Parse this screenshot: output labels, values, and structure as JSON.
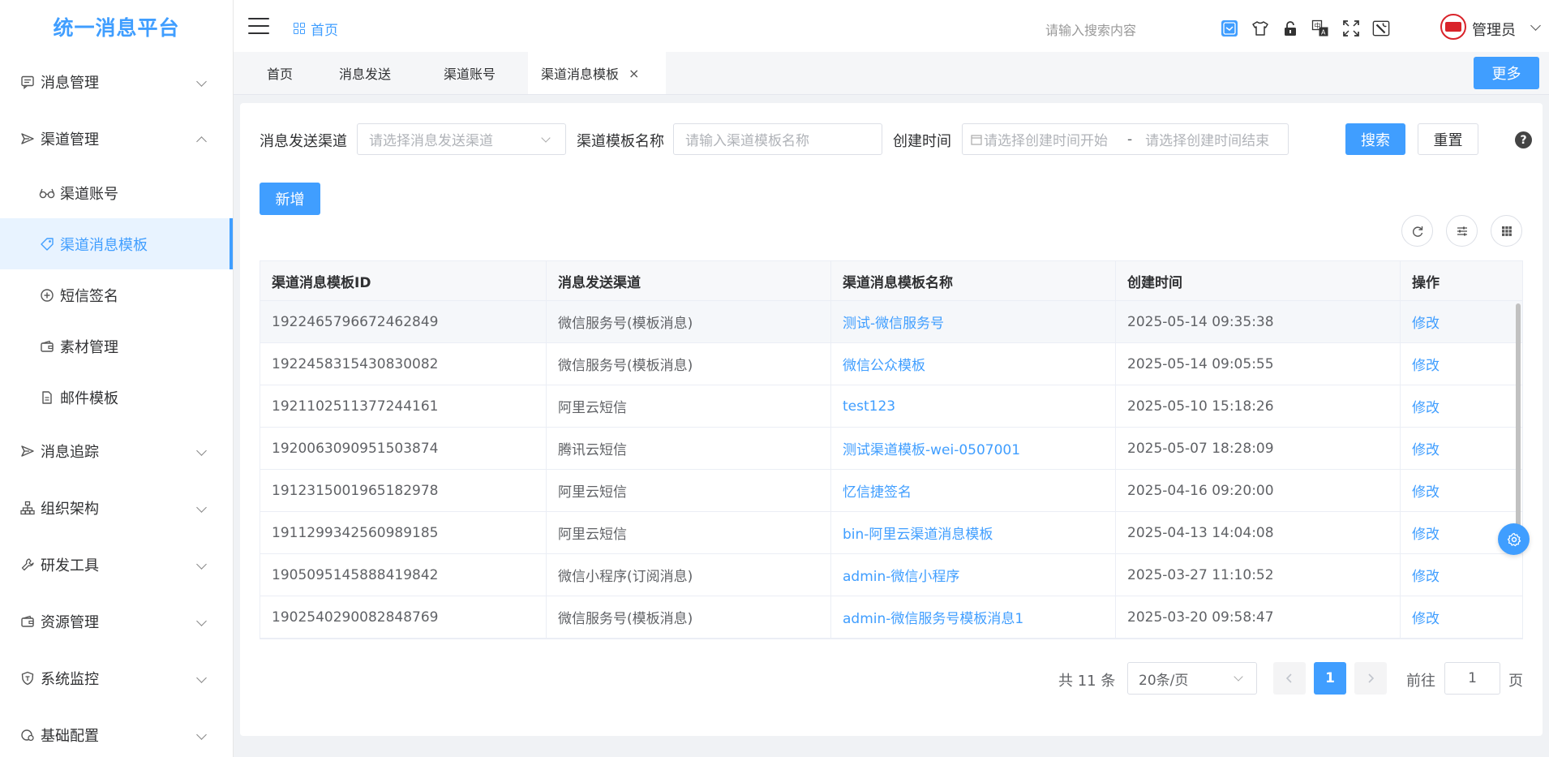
{
  "app": {
    "title": "统一消息平台"
  },
  "header": {
    "breadcrumb": "首页",
    "search_placeholder": "请输入搜索内容",
    "user_name": "管理员"
  },
  "sidebar": {
    "items": [
      {
        "label": "消息管理",
        "icon": "message-icon",
        "expanded": false
      },
      {
        "label": "渠道管理",
        "icon": "send-icon",
        "expanded": true,
        "children": [
          {
            "label": "渠道账号",
            "icon": "glasses-icon"
          },
          {
            "label": "渠道消息模板",
            "icon": "tag-icon",
            "active": true
          },
          {
            "label": "短信签名",
            "icon": "circle-plus-icon"
          },
          {
            "label": "素材管理",
            "icon": "wallet-icon"
          },
          {
            "label": "邮件模板",
            "icon": "document-icon"
          }
        ]
      },
      {
        "label": "消息追踪",
        "icon": "send-icon",
        "expanded": false
      },
      {
        "label": "组织架构",
        "icon": "org-chart-icon",
        "expanded": false
      },
      {
        "label": "研发工具",
        "icon": "wrench-icon",
        "expanded": false
      },
      {
        "label": "资源管理",
        "icon": "wallet-icon",
        "expanded": false
      },
      {
        "label": "系统监控",
        "icon": "shield-icon",
        "expanded": false
      },
      {
        "label": "基础配置",
        "icon": "settings-icon",
        "expanded": false
      }
    ]
  },
  "tabs": [
    {
      "label": "首页"
    },
    {
      "label": "消息发送"
    },
    {
      "label": "渠道账号"
    },
    {
      "label": "渠道消息模板",
      "active": true,
      "close": "×"
    }
  ],
  "more_label": "更多",
  "filters": {
    "channel_label": "消息发送渠道",
    "channel_placeholder": "请选择消息发送渠道",
    "name_label": "渠道模板名称",
    "name_placeholder": "请输入渠道模板名称",
    "time_label": "创建时间",
    "time_start_placeholder": "请选择创建时间开始",
    "time_separator": "-",
    "time_end_placeholder": "请选择创建时间结束",
    "search_label": "搜索",
    "reset_label": "重置",
    "help": "?"
  },
  "add_label": "新增",
  "table": {
    "headers": [
      "渠道消息模板ID",
      "消息发送渠道",
      "渠道消息模板名称",
      "创建时间",
      "操作"
    ],
    "rows": [
      {
        "id": "1922465796672462849",
        "channel": "微信服务号(模板消息)",
        "name": "测试-微信服务号",
        "time": "2025-05-14 09:35:38",
        "action": "修改"
      },
      {
        "id": "1922458315430830082",
        "channel": "微信服务号(模板消息)",
        "name": "微信公众模板",
        "time": "2025-05-14 09:05:55",
        "action": "修改"
      },
      {
        "id": "1921102511377244161",
        "channel": "阿里云短信",
        "name": "test123",
        "time": "2025-05-10 15:18:26",
        "action": "修改"
      },
      {
        "id": "1920063090951503874",
        "channel": "腾讯云短信",
        "name": "测试渠道模板-wei-0507001",
        "time": "2025-05-07 18:28:09",
        "action": "修改"
      },
      {
        "id": "1912315001965182978",
        "channel": "阿里云短信",
        "name": "忆信捷签名",
        "time": "2025-04-16 09:20:00",
        "action": "修改"
      },
      {
        "id": "1911299342560989185",
        "channel": "阿里云短信",
        "name": "bin-阿里云渠道消息模板",
        "time": "2025-04-13 14:04:08",
        "action": "修改"
      },
      {
        "id": "1905095145888419842",
        "channel": "微信小程序(订阅消息)",
        "name": "admin-微信小程序",
        "time": "2025-03-27 11:10:52",
        "action": "修改"
      },
      {
        "id": "1902540290082848769",
        "channel": "微信服务号(模板消息)",
        "name": "admin-微信服务号模板消息1",
        "time": "2025-03-20 09:58:47",
        "action": "修改"
      }
    ]
  },
  "pagination": {
    "total": "共 11 条",
    "page_size": "20条/页",
    "current": "1",
    "goto_label": "前往",
    "goto_value": "1",
    "page_unit": "页"
  },
  "colors": {
    "primary": "#409eff",
    "brand_logo": "#d9232a"
  }
}
